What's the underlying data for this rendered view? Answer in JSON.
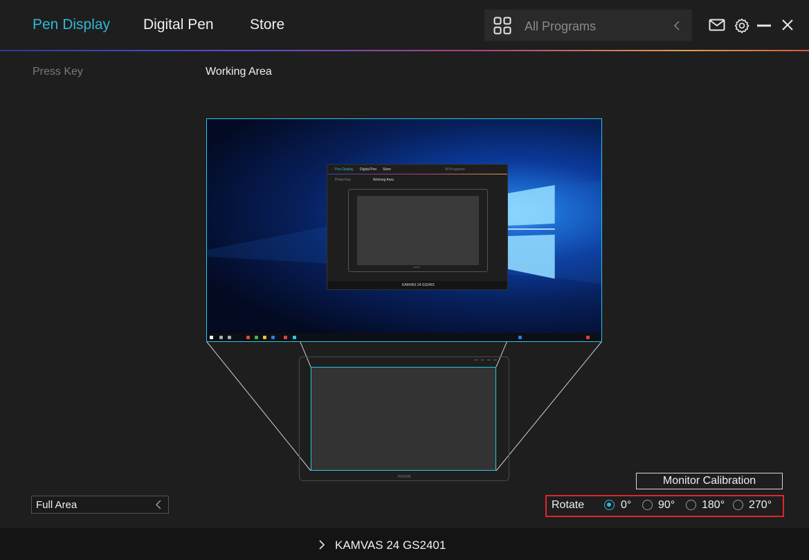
{
  "header": {
    "tabs": [
      {
        "label": "Pen Display",
        "active": true
      },
      {
        "label": "Digital Pen",
        "active": false
      },
      {
        "label": "Store",
        "active": false
      }
    ],
    "programs": {
      "label": "All Programs",
      "icon": "grid-icon",
      "chevron": "chevron-left-icon"
    },
    "icons": [
      "mail-icon",
      "gear-icon",
      "minimize-icon",
      "close-icon"
    ],
    "accent_color": "#2fb7d6"
  },
  "subtabs": [
    {
      "label": "Press Key",
      "active": false
    },
    {
      "label": "Working Area",
      "active": true
    }
  ],
  "preview": {
    "mini_window": {
      "tabs": [
        "Pen Display",
        "Digital Pen",
        "Store"
      ],
      "programs": "All Programs",
      "subtabs": [
        "Press Key",
        "Working Area"
      ],
      "device": "KAMVAS 24 GS2401",
      "brand": "HUION"
    },
    "tablet_brand": "HUION",
    "highlight_color": "#29c8e6"
  },
  "controls": {
    "calibration_label": "Monitor Calibration",
    "area_select": {
      "value": "Full Area",
      "chevron": "chevron-left-icon"
    },
    "rotate": {
      "label": "Rotate",
      "options": [
        "0°",
        "90°",
        "180°",
        "270°"
      ],
      "selected": "0°"
    },
    "highlight_box_color": "#e0262b"
  },
  "footer": {
    "device_name": "KAMVAS 24 GS2401",
    "chevron": "chevron-right-icon"
  }
}
